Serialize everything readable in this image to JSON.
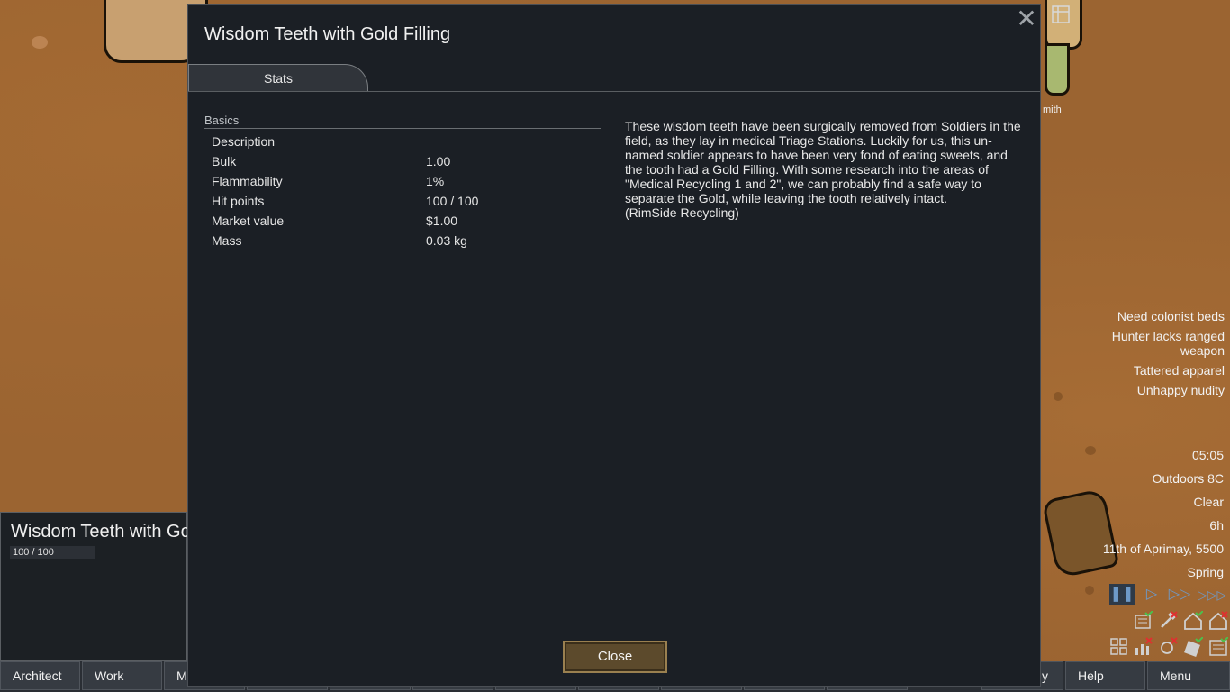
{
  "dialog": {
    "title": "Wisdom Teeth with Gold Filling",
    "tab": "Stats",
    "section": "Basics",
    "stats": [
      {
        "label": "Description",
        "value": ""
      },
      {
        "label": "Bulk",
        "value": "1.00"
      },
      {
        "label": "Flammability",
        "value": "1%"
      },
      {
        "label": "Hit points",
        "value": "100 / 100"
      },
      {
        "label": "Market value",
        "value": "$1.00"
      },
      {
        "label": "Mass",
        "value": "0.03 kg"
      }
    ],
    "description": "These wisdom teeth have been surgically removed from Soldiers in the field, as they lay in medical Triage Stations. Luckily for us, this un-named soldier appears to have been very fond of eating sweets, and the tooth had a Gold Filling. With some research into the areas of \"Medical Recycling 1 and 2\", we can probably find a safe way to separate the Gold, while leaving the tooth relatively intact.",
    "source": "(RimSide Recycling)",
    "close_label": "Close",
    "close_icon": "close-icon"
  },
  "map_label": "mith",
  "alerts": [
    "Need colonist beds",
    "Hunter lacks ranged weapon",
    "Tattered apparel",
    "Unhappy nudity"
  ],
  "time": {
    "clock": "05:05",
    "temperature": "Outdoors 8C",
    "weather": "Clear",
    "hours": "6h",
    "date": "11th of Aprimay, 5500",
    "season": "Spring"
  },
  "inspect": {
    "title": "Wisdom Teeth with Gold Filling",
    "hp": "100 / 100"
  },
  "bottom_bar": {
    "architect": "Architect",
    "work": "Work",
    "m": "M",
    "y": "y",
    "help": "Help",
    "menu": "Menu"
  },
  "colors": {
    "dialog_bg": "#1b1f25",
    "close_button": "#5c4a2c",
    "speed_icons": "#6e9ac8",
    "map": "#9b6431"
  }
}
